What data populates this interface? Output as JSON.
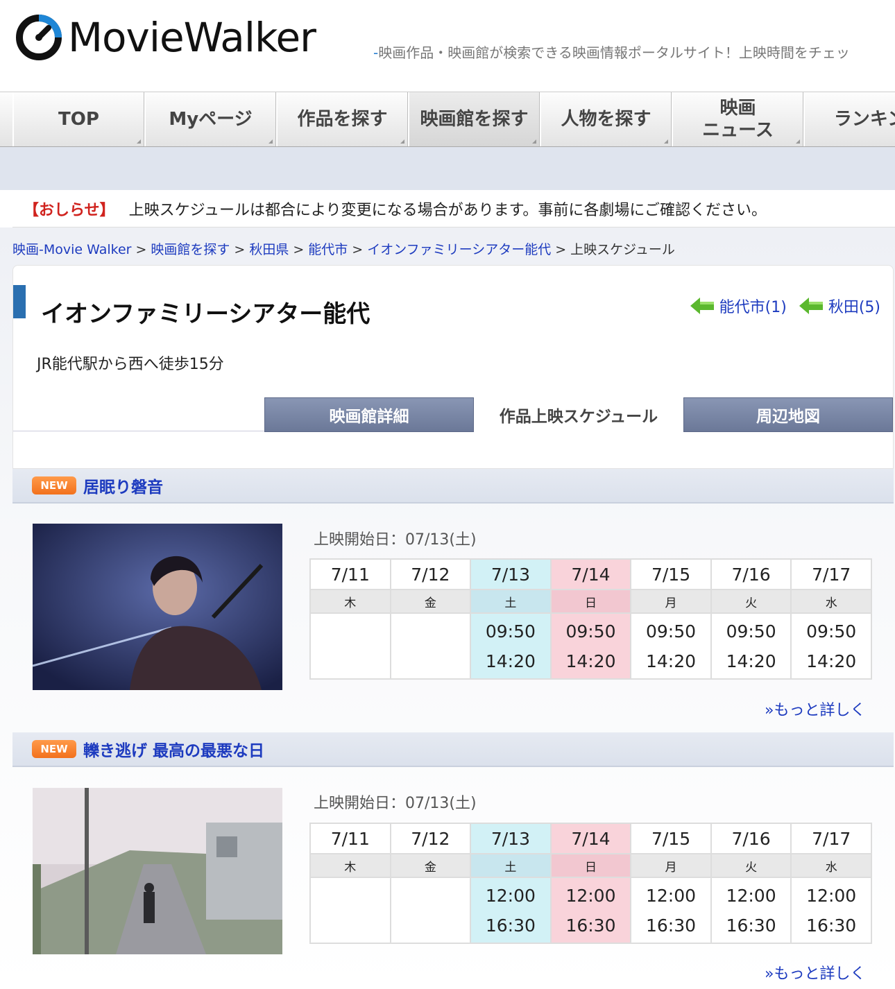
{
  "header": {
    "logo_text": "MovieWalker",
    "tagline_dash": "-",
    "tagline": "映画作品・映画館が検索できる映画情報ポータルサイト！上映時間をチェッ"
  },
  "nav": [
    {
      "label": "TOP"
    },
    {
      "label": "Myページ"
    },
    {
      "label": "作品を探す"
    },
    {
      "label": "映画館を探す"
    },
    {
      "label": "人物を探す"
    },
    {
      "label": "映画\nニュース"
    },
    {
      "label": "ランキン"
    }
  ],
  "notice": {
    "tag": "【おしらせ】",
    "text": "上映スケジュールは都合により変更になる場合があります。事前に各劇場にご確認ください。"
  },
  "breadcrumb": {
    "items": [
      "映画-Movie Walker",
      "映画館を探す",
      "秋田県",
      "能代市",
      "イオンファミリーシアター能代"
    ],
    "separator": ">",
    "current": "上映スケジュール"
  },
  "theater": {
    "name": "イオンファミリーシアター能代",
    "area_links": [
      "能代市(1)",
      "秋田(5)"
    ],
    "access": "JR能代駅から西へ徒歩15分"
  },
  "tabs": [
    "映画館詳細",
    "作品上映スケジュール",
    "周辺地図"
  ],
  "colors": {
    "link": "#1d3bbf",
    "notice_tag": "#d0231e",
    "saturday": "#d2f1f6",
    "sunday": "#f9d3da",
    "badge": "#f2711c"
  },
  "movies": [
    {
      "badge": "NEW",
      "title": "居眠り磐音",
      "start_date": "上映開始日：07/13(土)",
      "dates": [
        "7/11",
        "7/12",
        "7/13",
        "7/14",
        "7/15",
        "7/16",
        "7/17"
      ],
      "days": [
        "木",
        "金",
        "土",
        "日",
        "月",
        "火",
        "水"
      ],
      "times": [
        "",
        "",
        "09:50\n14:20",
        "09:50\n14:20",
        "09:50\n14:20",
        "09:50\n14:20",
        "09:50\n14:20"
      ],
      "more": "»もっと詳しく"
    },
    {
      "badge": "NEW",
      "title": "轢き逃げ 最高の最悪な日",
      "start_date": "上映開始日：07/13(土)",
      "dates": [
        "7/11",
        "7/12",
        "7/13",
        "7/14",
        "7/15",
        "7/16",
        "7/17"
      ],
      "days": [
        "木",
        "金",
        "土",
        "日",
        "月",
        "火",
        "水"
      ],
      "times": [
        "",
        "",
        "12:00\n16:30",
        "12:00\n16:30",
        "12:00\n16:30",
        "12:00\n16:30",
        "12:00\n16:30"
      ],
      "more": "»もっと詳しく"
    }
  ]
}
